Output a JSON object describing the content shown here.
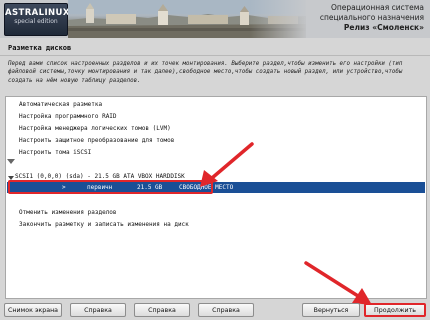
{
  "header": {
    "logo_main": "ASTRALINUX",
    "logo_sub": "special edition",
    "brand_line1": "Операционная система",
    "brand_line2": "специального назначения",
    "brand_line3": "Релиз «Смоленск»"
  },
  "section": {
    "title": "Разметка дисков",
    "description": "Перед вами список настроенных разделов и их точек монтирования. Выберите раздел,чтобы изменить его настройки (тип файловой системы,точку монтирования и так далее),свободное место,чтобы создать новый раздел, или устройство,чтобы создать на нём новую таблицу разделов."
  },
  "list": {
    "items_top": [
      "Автоматическая разметка",
      "Настройка программного RAID",
      "Настройка менеджера логических томов (LVM)",
      "Настроить защитное преобразование для томов",
      "Настроить тома iSCSI"
    ],
    "disk": "SCSI1 (0,0,0) (sda) - 21.5 GB ATA VBOX HARDDISK",
    "selected": {
      "marker": ">",
      "type": "первичн",
      "size": "21.5 GB",
      "label": "СВОБОДНОЕ МЕСТО"
    },
    "items_bottom": [
      "Отменить изменения разделов",
      "Закончить разметку и записать изменения на диск"
    ]
  },
  "buttons": {
    "screenshot": "Снимок экрана",
    "help1": "Справка",
    "help2": "Справка",
    "help3": "Справка",
    "back": "Вернуться",
    "continue": "Продолжить"
  },
  "colors": {
    "selection": "#1a4f96",
    "highlight": "#e0262a",
    "panel_bg": "#ffffff",
    "window_bg": "#d6d6d6"
  }
}
